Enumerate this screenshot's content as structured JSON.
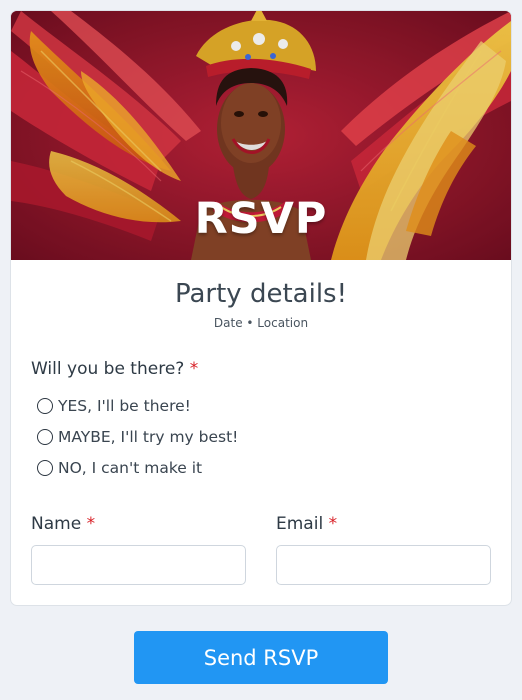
{
  "hero": {
    "title": "RSVP",
    "image_description_icon": "carnival-dancer-photo"
  },
  "event": {
    "title": "Party details!",
    "subtitle": "Date • Location"
  },
  "attendance": {
    "question": "Will you be there?",
    "required_mark": "*",
    "options": [
      "YES, I'll be there!",
      "MAYBE, I'll try my best!",
      "NO, I can't make it"
    ]
  },
  "name_field": {
    "label": "Name",
    "required_mark": "*",
    "value": "",
    "placeholder": ""
  },
  "email_field": {
    "label": "Email",
    "required_mark": "*",
    "value": "",
    "placeholder": ""
  },
  "submit": {
    "label": "Send RSVP"
  },
  "colors": {
    "background": "#eef1f6",
    "button": "#2196f3",
    "required": "#d81f26"
  }
}
